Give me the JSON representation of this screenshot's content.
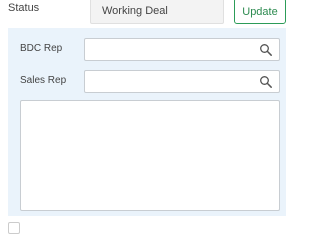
{
  "status": {
    "label": "Status",
    "value": "Working Deal",
    "update_label": "Update"
  },
  "bdc_rep": {
    "label": "BDC Rep",
    "value": "",
    "icon": "search-icon"
  },
  "sales_rep": {
    "label": "Sales Rep",
    "value": "",
    "icon": "search-icon"
  },
  "notes": {
    "value": ""
  },
  "colors": {
    "panel_bg": "#eaf3fb",
    "accent_green": "#2c9c58",
    "field_bg": "#f3f3f3"
  }
}
